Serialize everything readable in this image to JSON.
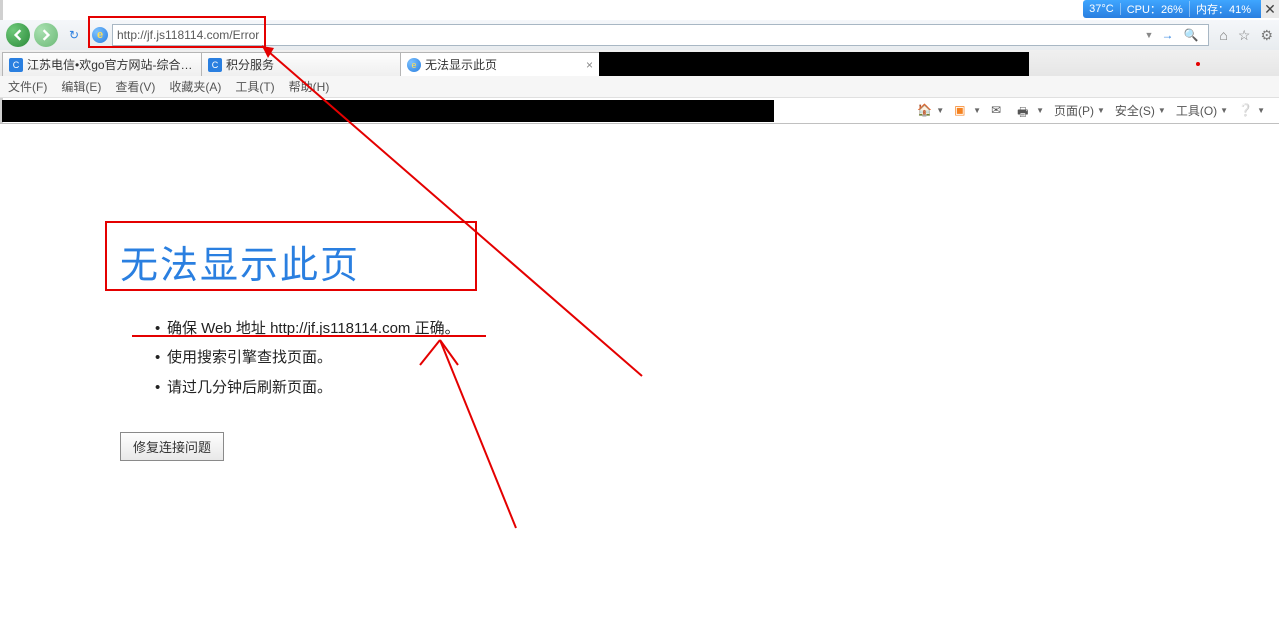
{
  "sysmon": {
    "temp": "37°C",
    "cpu": "CPU：26%",
    "mem": "内存：41%"
  },
  "nav": {
    "url": "http://jf.js118114.com/Error"
  },
  "tabs": [
    {
      "label": "江苏电信•欢go官方网站-综合…",
      "favicon": "C"
    },
    {
      "label": "积分服务",
      "favicon": "C"
    },
    {
      "label": "无法显示此页",
      "favicon": "e",
      "active": true,
      "closable": true
    }
  ],
  "menubar": [
    "文件(F)",
    "编辑(E)",
    "查看(V)",
    "收藏夹(A)",
    "工具(T)",
    "帮助(H)"
  ],
  "cmdbar": {
    "page": "页面(P)",
    "safety": "安全(S)",
    "tools": "工具(O)"
  },
  "error": {
    "heading": "无法显示此页",
    "bullets": [
      "确保 Web 地址 http://jf.js118114.com 正确。",
      "使用搜索引擎查找页面。",
      "请过几分钟后刷新页面。"
    ],
    "fix_button": "修复连接问题"
  }
}
